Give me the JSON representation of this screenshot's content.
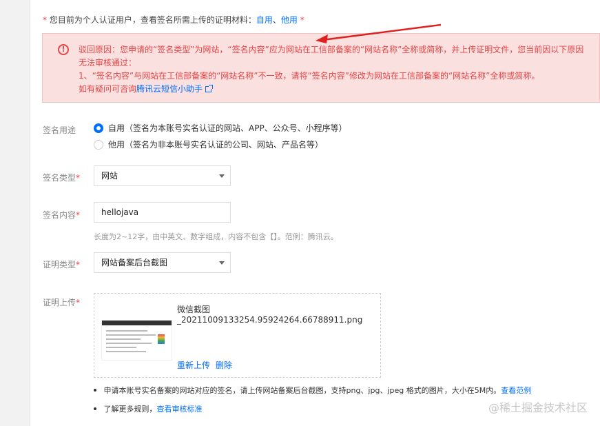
{
  "notice": {
    "star": "*",
    "text": "您目前为个人认证用户，查看签名所需上传的证明材料：",
    "link_self": "自用",
    "separator": "、",
    "link_other": "他用",
    "star_end": " *"
  },
  "alert": {
    "icon": "!",
    "line1": "驳回原因：您申请的“签名类型”为网站，“签名内容”应为网站在工信部备案的“网站名称”全称或简称，并上传证明文件，您当前因以下原因无法审核通过：",
    "line2": "1、“签名内容”与网站在工信部备案的“网站名称”不一致，请将“签名内容”修改为网站在工信部备案的“网站名称”全称或简称。",
    "line3_prefix": "如有疑问可咨询",
    "line3_link": "腾讯云短信小助手"
  },
  "form": {
    "usage": {
      "label": "签名用途",
      "options": [
        {
          "label": "自用（签名为本账号实名认证的网站、APP、公众号、小程序等）",
          "checked": true
        },
        {
          "label": "他用（签名为非本账号实名认证的公司、网站、产品名等）",
          "checked": false
        }
      ]
    },
    "type": {
      "label": "签名类型",
      "value": "网站"
    },
    "content": {
      "label": "签名内容",
      "value": "hellojava",
      "hint": "长度为2~12字，由中英文、数字组成，内容不包含【】。范例：腾讯云。"
    },
    "proof_type": {
      "label": "证明类型",
      "value": "网站备案后台截图"
    },
    "upload": {
      "label": "证明上传",
      "filename": "微信截图_20211009133254.95924264.66788911.png",
      "reupload": "重新上传",
      "delete": "删除"
    },
    "required_mark": "*",
    "tips": {
      "tip1_text": "申请本账号实名备案的网站对应的签名，请上传网站备案后台截图，支持png、jpg、jpeg 格式的图片，大小在5M内。",
      "tip1_link": "查看范例",
      "tip2_text": "了解更多规则，",
      "tip2_link": "查看审核标准"
    }
  },
  "watermark": "@稀土掘金技术社区",
  "colors": {
    "accent": "#006eff",
    "error": "#e54545",
    "alert_bg": "#fbe0e0"
  }
}
